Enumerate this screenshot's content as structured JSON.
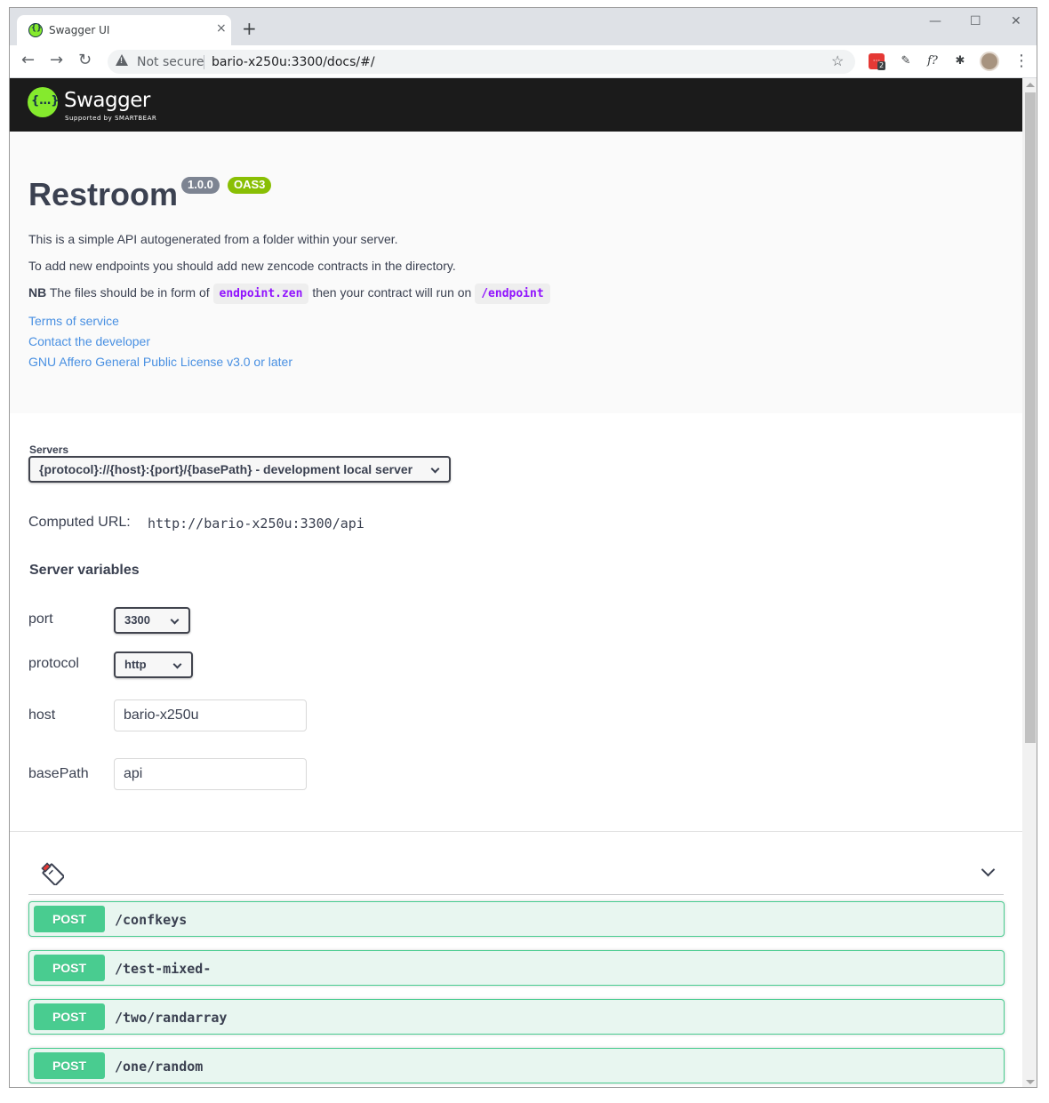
{
  "browser": {
    "tab_title": "Swagger UI",
    "tab_close": "×",
    "new_tab": "+",
    "minimize": "—",
    "maximize": "☐",
    "close": "✕",
    "back": "←",
    "forward": "→",
    "reload": "↻",
    "security_label": "Not secure",
    "url": "bario-x250u:3300/docs/#/",
    "star": "☆",
    "ext_badge": "2",
    "ext_font": "f?",
    "ext_puzzle": "✱",
    "menu": "⋮",
    "icons": [
      "warning-icon",
      "star-icon",
      "extension-icon",
      "puzzle-icon",
      "avatar"
    ]
  },
  "topbar": {
    "logo_text": "Swagger",
    "logo_sub": "Supported by SMARTBEAR"
  },
  "info": {
    "title": "Restroom",
    "version": "1.0.0",
    "oas": "OAS3",
    "desc1": "This is a simple API autogenerated from a folder within your server.",
    "desc2": "To add new endpoints you should add new zencode contracts in the directory.",
    "nb": "NB",
    "desc3_a": "The files should be in form of",
    "code1": "endpoint.zen",
    "desc3_b": "then your contract will run on",
    "code2": "/endpoint",
    "links": [
      "Terms of service",
      "Contact the developer",
      "GNU Affero General Public License v3.0 or later"
    ]
  },
  "servers": {
    "label": "Servers",
    "selected": "{protocol}://{host}:{port}/{basePath} - development local server",
    "computed_label": "Computed URL:",
    "computed_url": "http://bario-x250u:3300/api",
    "vars_title": "Server variables",
    "vars": {
      "port": {
        "label": "port",
        "value": "3300"
      },
      "protocol": {
        "label": "protocol",
        "value": "http"
      },
      "host": {
        "label": "host",
        "value": "bario-x250u"
      },
      "basePath": {
        "label": "basePath",
        "value": "api"
      }
    }
  },
  "operations": [
    {
      "method": "POST",
      "path": "/confkeys"
    },
    {
      "method": "POST",
      "path": "/test-mixed-"
    },
    {
      "method": "POST",
      "path": "/two/randarray"
    },
    {
      "method": "POST",
      "path": "/one/random"
    }
  ],
  "colors": {
    "post": "#49cc90",
    "post_bg": "#e8f6f0",
    "link": "#4990e2",
    "code": "#9012fe",
    "swagger_green": "#85ea2d",
    "oas_badge": "#89bf04",
    "version_badge": "#7d8492"
  }
}
